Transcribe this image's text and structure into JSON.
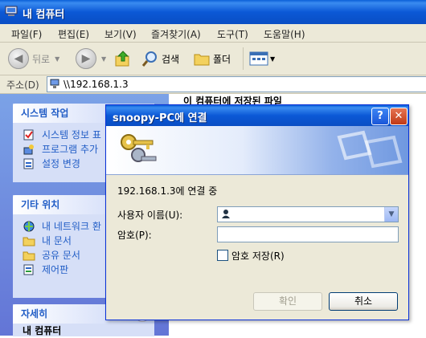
{
  "window": {
    "title": "내 컴퓨터"
  },
  "menu": [
    "파일(F)",
    "편집(E)",
    "보기(V)",
    "즐겨찾기(A)",
    "도구(T)",
    "도움말(H)"
  ],
  "toolbar": {
    "back_label": "뒤로",
    "search_label": "검색",
    "folders_label": "폴더"
  },
  "address": {
    "label": "주소(D)",
    "value": "\\\\192.168.1.3"
  },
  "sidebar": {
    "system_tasks": {
      "title": "시스템 작업",
      "items": [
        "시스템 정보 표",
        "프로그램 추가",
        "설정 변경"
      ]
    },
    "other_places": {
      "title": "기타 위치",
      "items": [
        "내 네트워크 환",
        "내 문서",
        "공유 문서",
        "제어판"
      ]
    },
    "details": {
      "title": "자세히",
      "partial_item": "내 컴퓨터"
    }
  },
  "content": {
    "heading": "이 컴퓨터에 저장된 파일"
  },
  "dialog": {
    "title": "snoopy-PC에 연결",
    "connecting_text": "192.168.1.3에 연결 중",
    "username_label": "사용자 이름(U):",
    "username_value": "",
    "password_label": "암호(P):",
    "password_value": "",
    "remember_label": "암호 저장(R)",
    "remember_checked": false,
    "ok_label": "확인",
    "cancel_label": "취소",
    "help_glyph": "?",
    "close_glyph": "✕"
  },
  "colors": {
    "title_blue": "#0b58d6",
    "panel_link": "#215dc6",
    "close_red": "#c03a16"
  }
}
